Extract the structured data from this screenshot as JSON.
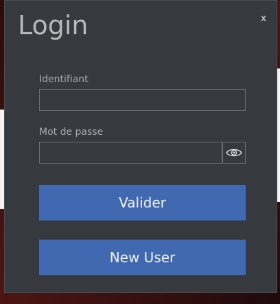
{
  "window": {
    "title": "Login",
    "close_label": "x"
  },
  "form": {
    "identifier_label": "Identifiant",
    "identifier_value": "",
    "password_label": "Mot de passe",
    "password_value": "",
    "eye_icon": "eye-icon"
  },
  "buttons": {
    "submit_label": "Valider",
    "new_user_label": "New User"
  },
  "colors": {
    "window_bg": "#36393d",
    "accent": "#4169b2",
    "title_text": "#b7b9bb",
    "label_text": "#a9abad",
    "input_border": "#6c6f72"
  }
}
